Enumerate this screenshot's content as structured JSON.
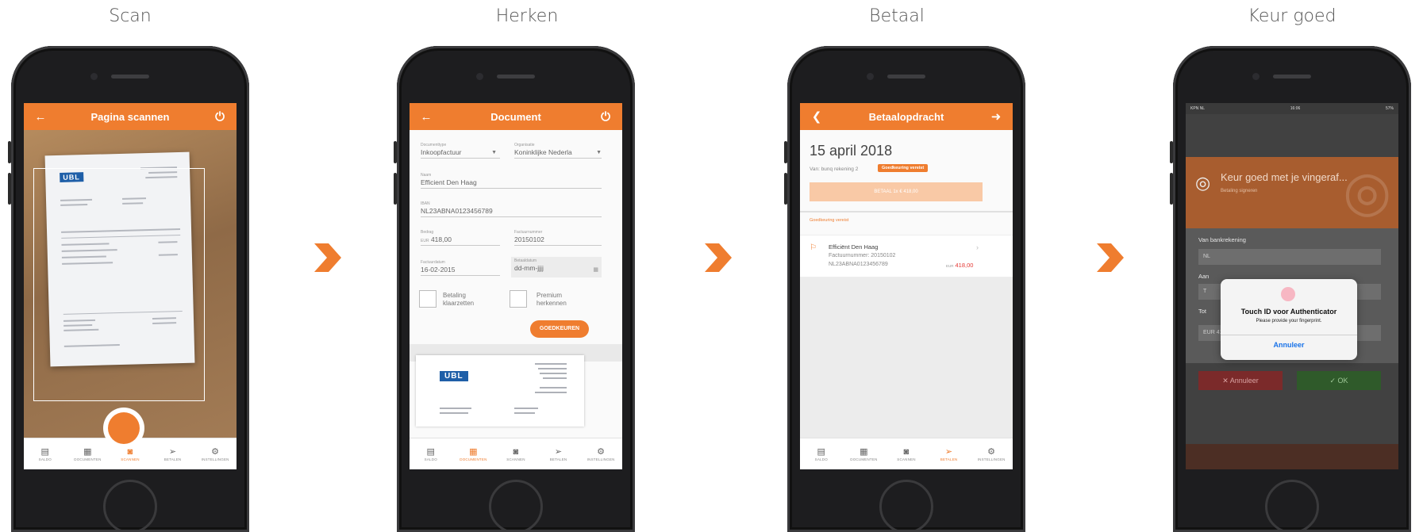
{
  "steps": [
    {
      "title": "Scan"
    },
    {
      "title": "Herken"
    },
    {
      "title": "Betaal"
    },
    {
      "title": "Keur goed"
    }
  ],
  "colors": {
    "accent": "#ef7d2f",
    "arrow": "#ef7d2f"
  },
  "tabs": [
    "SALDO",
    "DOCUMENTEN",
    "SCANNEN",
    "BETALEN",
    "INSTELLINGEN"
  ],
  "tab_icons": [
    "saldo-icon",
    "documents-icon",
    "camera-icon",
    "pay-icon",
    "gear-icon"
  ],
  "scan": {
    "title": "Pagina scannen",
    "doc_logo": "UBL",
    "active_tab": "SCANNEN"
  },
  "document": {
    "title": "Document",
    "documenttype_label": "Documenttype",
    "documenttype_value": "Inkoopfactuur",
    "organisatie_label": "Organisatie",
    "organisatie_value": "Koninklijke Nederla",
    "naam_label": "Naam",
    "naam_value": "Efficient Den Haag",
    "iban_label": "IBAN",
    "iban_value": "NL23ABNA0123456789",
    "bedrag_label": "Bedrag",
    "bedrag_currency": "EUR",
    "bedrag_value": "418,00",
    "factuurnummer_label": "Factuurnummer",
    "factuurnummer_value": "20150102",
    "factuurdatum_label": "Factuurdatum",
    "factuurdatum_value": "16-02-2015",
    "betaaldatum_label": "Betaaldatum",
    "betaaldatum_value": "dd-mm-jjjj",
    "betaling_klaarzetten": "Betaling klaarzetten",
    "premium_herkennen": "Premium herkennen",
    "approve_button": "GOEDKEUREN",
    "doc_logo": "UBL",
    "active_tab": "DOCUMENTEN"
  },
  "payment": {
    "title": "Betaalopdracht",
    "date": "15 april 2018",
    "from": "Van: bunq rekening 2",
    "badge": "Goedkeuring vereist",
    "pay_button": "BETAAL 1x € 418,00",
    "section": "Goedkeuring vereist",
    "item_name": "Efficiënt Den Haag",
    "item_invoice": "Factuurnummer: 20150102",
    "item_iban": "NL23ABNA0123456789",
    "item_currency": "EUR",
    "item_amount": "418,00",
    "active_tab": "BETALEN"
  },
  "approve": {
    "status_carrier": "KPN NL",
    "status_time": "16:06",
    "status_battery": "57%",
    "header_title": "Keur goed met je vingeraf...",
    "header_subtitle": "Betaling signeren",
    "van_label": "Van bankrekening",
    "van_value": "NL",
    "aan_label": "Aan",
    "aan_value": "T",
    "tot_label": "Tot",
    "amount_value": "EUR 418,00",
    "cancel": "Annuleer",
    "ok": "OK",
    "touchid_title": "Touch ID voor Authenticator",
    "touchid_sub": "Please provide your fingerprint.",
    "touchid_button": "Annuleer"
  }
}
